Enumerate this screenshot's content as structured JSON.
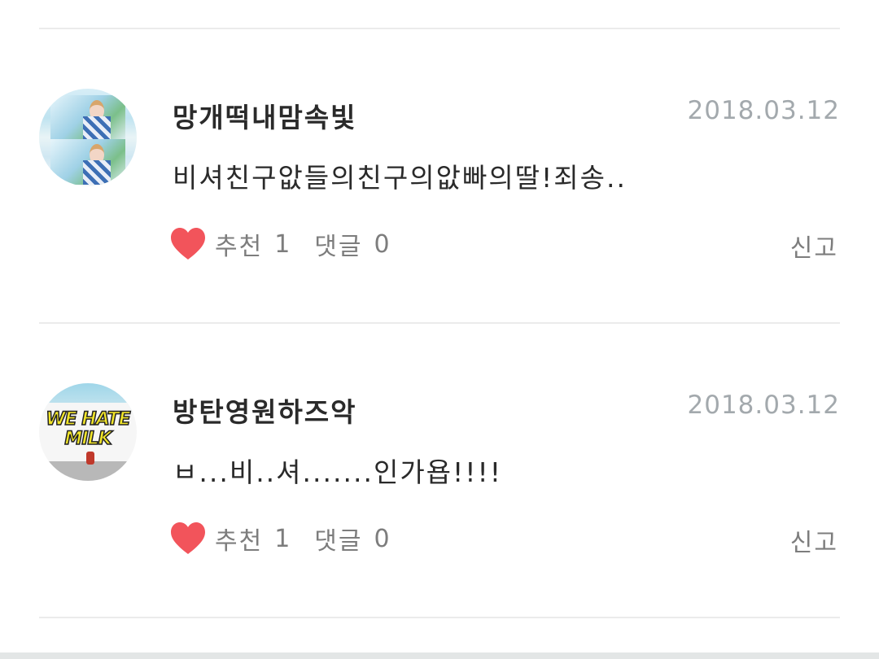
{
  "comments": [
    {
      "username": "망개떡내맘속빛",
      "date": "2018.03.12",
      "text": "비셔친구앖들의친구의앖빠의딸!죄송..",
      "like_label": "추천",
      "like_count": "1",
      "reply_label": "댓글",
      "reply_count": "0",
      "report_label": "신고",
      "avatar_icon": "profile-photo"
    },
    {
      "username": "방탄영원하즈악",
      "date": "2018.03.12",
      "text": "ㅂ...비..셔.......인가욥!!!!",
      "like_label": "추천",
      "like_count": "1",
      "reply_label": "댓글",
      "reply_count": "0",
      "report_label": "신고",
      "avatar_icon": "profile-photo",
      "avatar_text_top": "WE HATE",
      "avatar_text_bottom": "MILK"
    }
  ],
  "colors": {
    "heart": "#f2545b",
    "date": "#a3a9ad",
    "action_text": "#7d7d7d",
    "divider": "#ebebeb"
  }
}
